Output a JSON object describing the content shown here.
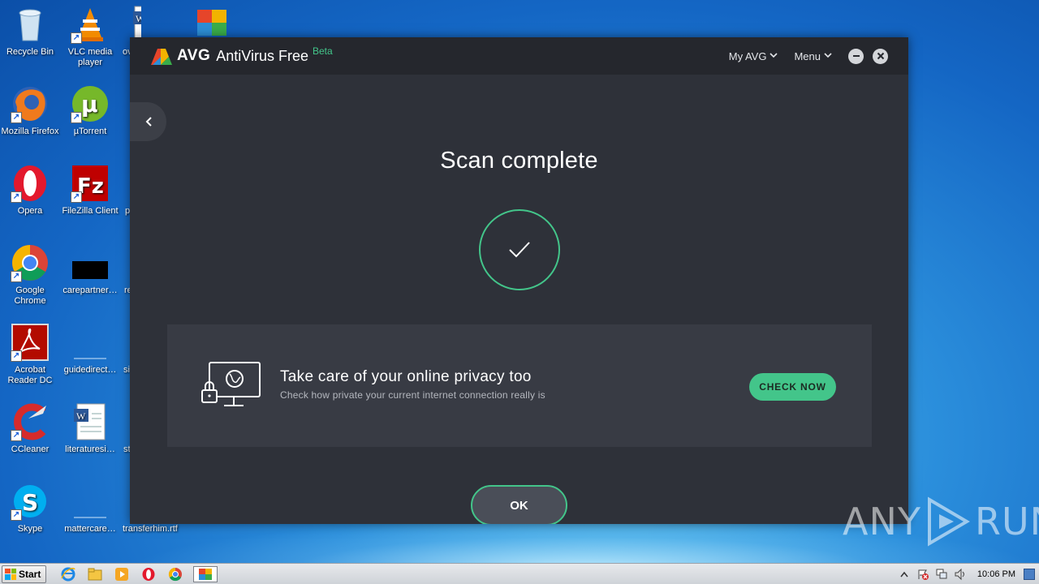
{
  "desktop": {
    "icons": [
      {
        "label": "Recycle Bin"
      },
      {
        "label": "VLC media player"
      },
      {
        "label": "ov"
      },
      {
        "label": "Mozilla Firefox"
      },
      {
        "label": "µTorrent"
      },
      {
        "label": "Opera"
      },
      {
        "label": "FileZilla Client"
      },
      {
        "label": "p"
      },
      {
        "label": "Google Chrome"
      },
      {
        "label": "carepartner…"
      },
      {
        "label": "re"
      },
      {
        "label": "Acrobat Reader DC"
      },
      {
        "label": "guidedirect…"
      },
      {
        "label": "si"
      },
      {
        "label": "CCleaner"
      },
      {
        "label": "literaturesi…"
      },
      {
        "label": "st"
      },
      {
        "label": "Skype"
      },
      {
        "label": "mattercare…"
      },
      {
        "label": "transferhim.rtf"
      }
    ]
  },
  "avg": {
    "brand": "AVG",
    "product": "AntiVirus Free",
    "beta": "Beta",
    "nav": {
      "my_avg": "My AVG",
      "menu": "Menu"
    },
    "minimize": "–",
    "close": "×",
    "back": "‹",
    "scan_title": "Scan complete",
    "promo": {
      "title": "Take care of your online privacy too",
      "subtitle": "Check how private your current internet connection really is",
      "button": "CHECK NOW"
    },
    "ok": "OK",
    "accent_color": "#43c58a"
  },
  "watermark": {
    "left": "ANY",
    "right": "RUN"
  },
  "taskbar": {
    "start": "Start",
    "clock": "10:06 PM",
    "apps": [
      "ie-icon",
      "explorer-icon",
      "media-player-icon",
      "opera-icon",
      "chrome-icon",
      "avg-icon"
    ]
  }
}
